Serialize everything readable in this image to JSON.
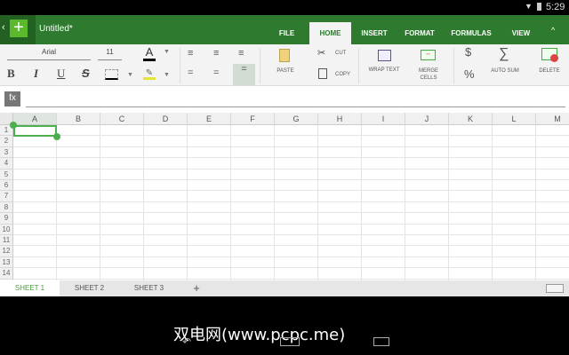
{
  "status": {
    "time": "5:29"
  },
  "title": "Untitled*",
  "tabs": [
    "FILE",
    "HOME",
    "INSERT",
    "FORMAT",
    "FORMULAS",
    "VIEW"
  ],
  "ribbon": {
    "font": "Arial",
    "size": "11",
    "paste": "PASTE",
    "cut": "CUT",
    "copy": "COPY",
    "wrap": "WRAP TEXT",
    "merge1": "MERGE",
    "merge2": "CELLS",
    "dollar": "$",
    "percent": "%",
    "autosum": "AUTO SUM",
    "delete": "DELETE",
    "bold": "B",
    "italic": "I",
    "underline": "U",
    "strike": "S",
    "fontcolor": "A"
  },
  "formula": {
    "fx": "fx",
    "value": ""
  },
  "columns": [
    "A",
    "B",
    "C",
    "D",
    "E",
    "F",
    "G",
    "H",
    "I",
    "J",
    "K",
    "L",
    "M"
  ],
  "rows": [
    "1",
    "2",
    "3",
    "4",
    "5",
    "6",
    "7",
    "8",
    "9",
    "10",
    "11",
    "12",
    "13",
    "14"
  ],
  "sheets": [
    "SHEET 1",
    "SHEET 2",
    "SHEET 3"
  ],
  "add_sheet": "+",
  "watermark": "双电网(www.pcpc.me)"
}
